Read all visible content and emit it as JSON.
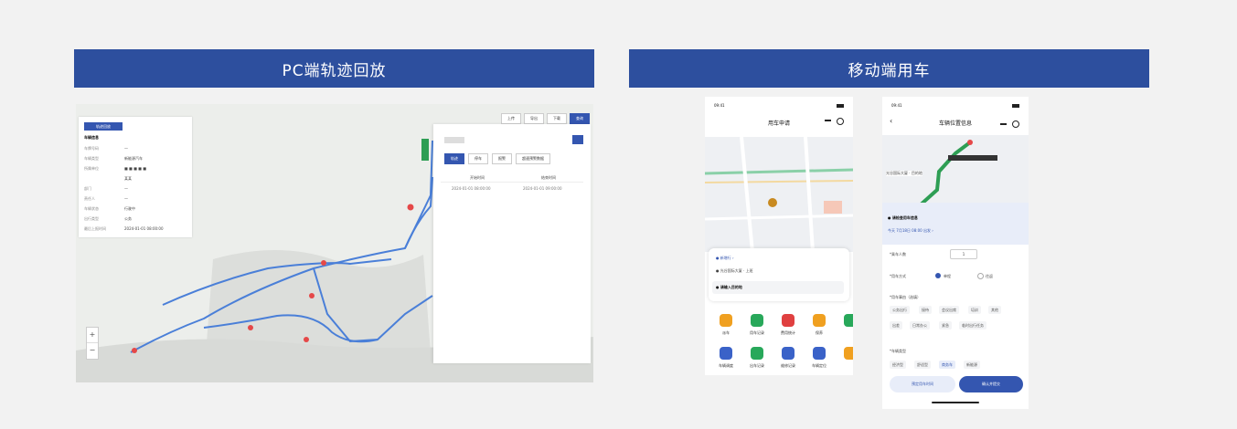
{
  "colors": {
    "brand_blue": "#2d4f9e",
    "accent_blue": "#3456b0",
    "route_blue": "#4a7fd8",
    "marker_red": "#e54848",
    "background": "#f2f2f2"
  },
  "banners": {
    "left": "PC端轨迹回放",
    "right": "移动端用车"
  },
  "pc": {
    "badge": "轨迹回放",
    "info_title": "车辆信息",
    "info_rows": [
      [
        "车牌号码",
        "—"
      ],
      [
        "车辆类型",
        "新能源汽车"
      ],
      [
        "所属单位",
        "■ ■ ■ ■ ■"
      ],
      [
        "",
        "某某"
      ],
      [
        "部门",
        "—"
      ],
      [
        "责任人",
        "—"
      ],
      [
        "车辆状态",
        "行驶中"
      ],
      [
        "出行类型",
        "公务"
      ],
      [
        "最后上报时间",
        "2024-01-01 08:00:00"
      ]
    ],
    "toolbar": [
      "上传",
      "导出",
      "下载",
      "查询"
    ],
    "panel_tabs": [
      "轨迹",
      "停车",
      "报警",
      "超速预警数据"
    ],
    "panel_headers": [
      "开始时间",
      "结束时间"
    ],
    "panel_row": [
      "2024-01-01 08:00:00",
      "2024-01-01 09:00:00"
    ]
  },
  "phone1": {
    "time": "09:41",
    "title": "用车申请",
    "card": {
      "line1": "● 新增行 ›",
      "line2": "● 光谷国际大厦 · 上班",
      "line3": "● 请输入目的地"
    },
    "grid": [
      {
        "label": "派车",
        "color": "#f0a020"
      },
      {
        "label": "用车记录",
        "color": "#28a85a"
      },
      {
        "label": "费用统计",
        "color": "#e04040"
      },
      {
        "label": "保养",
        "color": "#f0a020"
      },
      {
        "label": "",
        "color": "#28a85a"
      },
      {
        "label": "车辆调度",
        "color": "#3a62c8"
      },
      {
        "label": "出车记录",
        "color": "#28a85a"
      },
      {
        "label": "维修记录",
        "color": "#3a62c8"
      },
      {
        "label": "车辆定位",
        "color": "#3a62c8"
      },
      {
        "label": "",
        "color": "#f0a020"
      }
    ]
  },
  "phone2": {
    "time": "09:41",
    "title": "车辆位置信息",
    "map_label": "光谷国际大厦 · 目的地",
    "section_title": "● 请检查用车信息",
    "summary": "今天 7月18日 08:00 出发 ›",
    "passenger_label": "*乘车人数",
    "passenger_value": "1",
    "trip_label": "*用车方式",
    "trip_options": [
      "单程",
      "往返"
    ],
    "purpose_label": "*用车事由（选填）",
    "purpose_chips": [
      "公务出行",
      "接待",
      "会议出席",
      "培训",
      "其他"
    ],
    "purpose_chips2": [
      "出差",
      "日常办公",
      "紧急",
      "临时出行任务"
    ],
    "vehicle_label": "*车辆类型",
    "vehicle_chips": [
      "经济型",
      "舒适型",
      "商务车",
      "新能源"
    ],
    "btn_secondary": "预定用车时间",
    "btn_primary": "确认并提交"
  }
}
